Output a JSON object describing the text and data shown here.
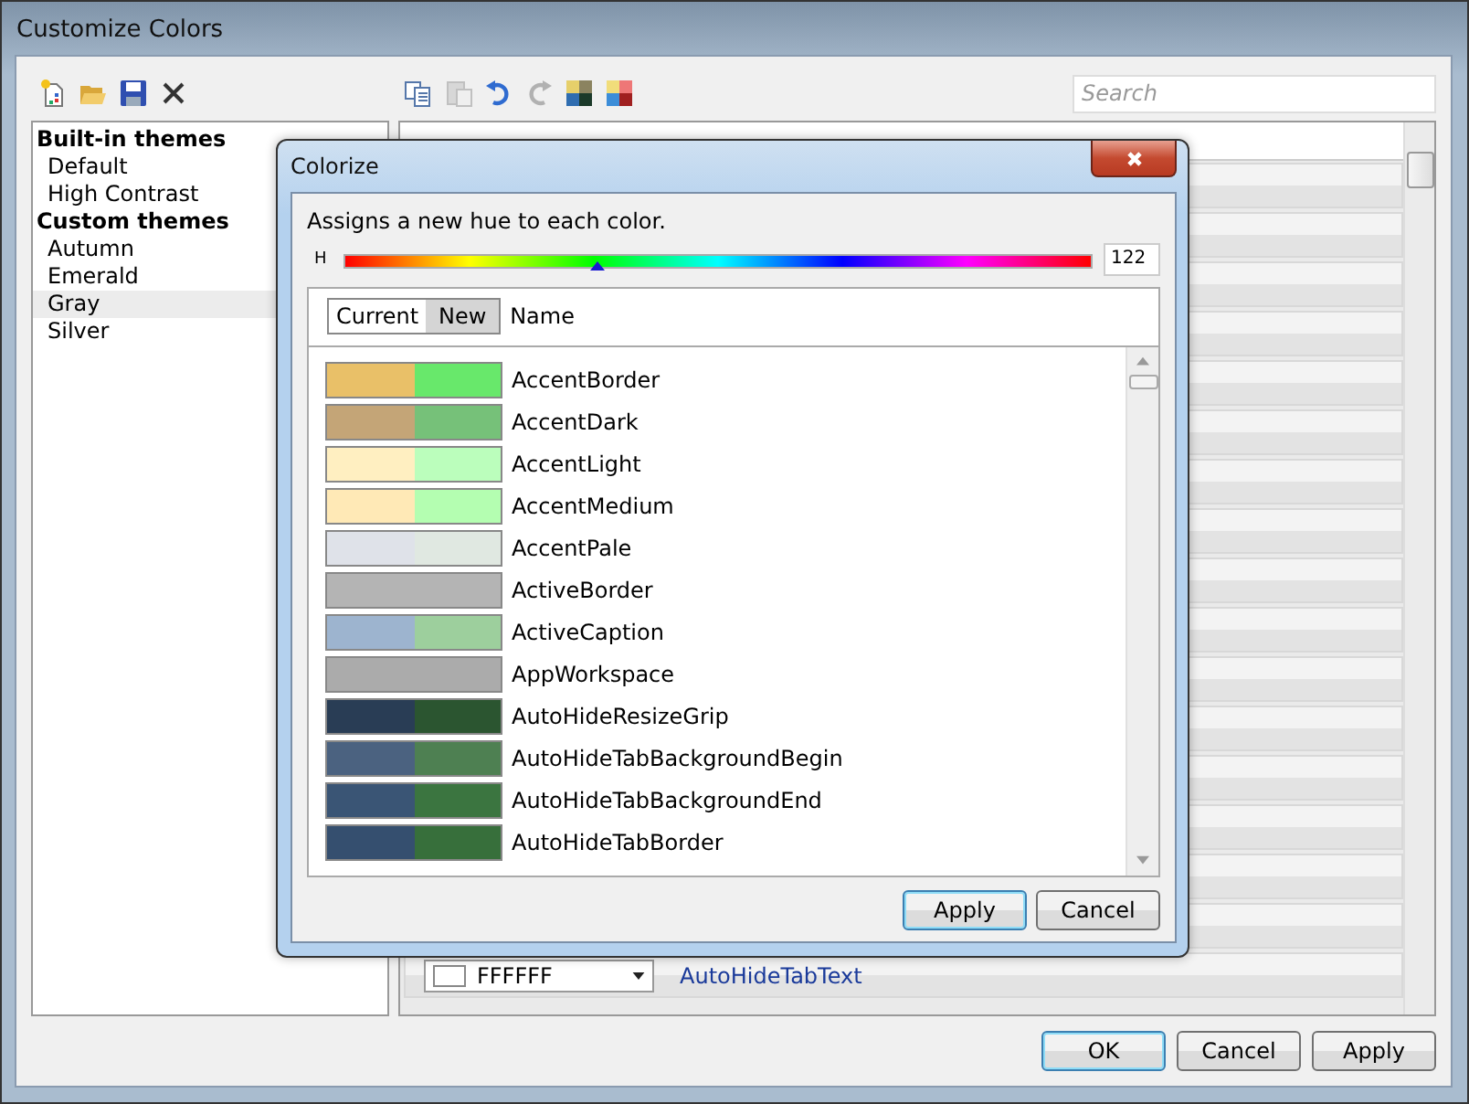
{
  "window": {
    "title": "Customize Colors"
  },
  "toolbar_left": [
    {
      "kind": "new"
    },
    {
      "kind": "open"
    },
    {
      "kind": "save"
    },
    {
      "kind": "delete"
    }
  ],
  "toolbar_right": [
    {
      "kind": "copy",
      "disabled": false
    },
    {
      "kind": "paste",
      "disabled": true
    },
    {
      "kind": "undo",
      "disabled": false
    },
    {
      "kind": "redo",
      "disabled": true
    },
    {
      "kind": "theme-a",
      "disabled": false
    },
    {
      "kind": "theme-b",
      "disabled": false
    }
  ],
  "search": {
    "placeholder": "Search"
  },
  "themes": [
    {
      "label": "Built-in themes",
      "children": [
        {
          "label": "Default",
          "selected": false
        },
        {
          "label": "High Contrast",
          "selected": false
        }
      ]
    },
    {
      "label": "Custom themes",
      "children": [
        {
          "label": "Autumn",
          "selected": false
        },
        {
          "label": "Emerald",
          "selected": false
        },
        {
          "label": "Gray",
          "selected": true
        },
        {
          "label": "Silver",
          "selected": false
        }
      ]
    }
  ],
  "grid_last_row": {
    "value": "FFFFFF",
    "name": "AutoHideTabText"
  },
  "buttons": [
    "OK",
    "Cancel",
    "Apply"
  ],
  "dialog": {
    "title": "Colorize",
    "description": "Assigns a new hue to each color.",
    "hue_label": "H",
    "hue": {
      "level": 0.339
    },
    "hue_value": "122",
    "columns": {
      "current": "Current",
      "new": "New",
      "name": "Name"
    },
    "rows": [
      {
        "name": "AccentBorder",
        "current": {
          "color": "#e9c068"
        },
        "new": {
          "color": "#68e86b"
        }
      },
      {
        "name": "AccentDark",
        "current": {
          "color": "#c4a577"
        },
        "new": {
          "color": "#76c179"
        }
      },
      {
        "name": "AccentLight",
        "current": {
          "color": "#ffefc1"
        },
        "new": {
          "color": "#bbfebc"
        }
      },
      {
        "name": "AccentMedium",
        "current": {
          "color": "#ffe9b6"
        },
        "new": {
          "color": "#b4feb1"
        }
      },
      {
        "name": "AccentPale",
        "current": {
          "color": "#dfe2e9"
        },
        "new": {
          "color": "#e0e8e1"
        }
      },
      {
        "name": "ActiveBorder",
        "current": {
          "color": "#b4b4b4"
        },
        "new": {
          "color": "#b4b4b4"
        }
      },
      {
        "name": "ActiveCaption",
        "current": {
          "color": "#9db4cf"
        },
        "new": {
          "color": "#9dcf9d"
        }
      },
      {
        "name": "AppWorkspace",
        "current": {
          "color": "#ababab"
        },
        "new": {
          "color": "#ababab"
        }
      },
      {
        "name": "AutoHideResizeGrip",
        "current": {
          "color": "#293d55"
        },
        "new": {
          "color": "#2b5530"
        }
      },
      {
        "name": "AutoHideTabBackgroundBegin",
        "current": {
          "color": "#4b6280"
        },
        "new": {
          "color": "#4e8052"
        }
      },
      {
        "name": "AutoHideTabBackgroundEnd",
        "current": {
          "color": "#3a5575"
        },
        "new": {
          "color": "#3b7540"
        }
      },
      {
        "name": "AutoHideTabBorder",
        "current": {
          "color": "#354f6f"
        },
        "new": {
          "color": "#376f3b"
        }
      }
    ],
    "buttons": [
      "Apply",
      "Cancel"
    ]
  }
}
